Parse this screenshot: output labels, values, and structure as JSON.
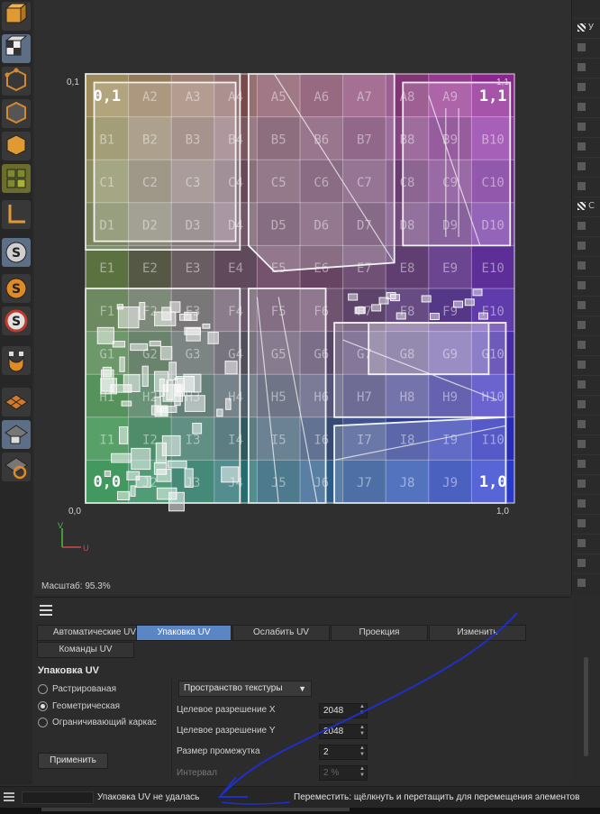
{
  "viewport": {
    "coords": {
      "top_left": "0,1",
      "top_right": "1,1",
      "bottom_left": "0,0",
      "bottom_right": "1,0"
    },
    "axis": {
      "v": "V",
      "u": "U"
    },
    "scale_label": "Масштаб: 95.3%",
    "uv_grid": {
      "rows": [
        "A",
        "B",
        "C",
        "D",
        "E",
        "F",
        "G",
        "H",
        "I",
        "J"
      ],
      "cols": [
        "1",
        "2",
        "3",
        "4",
        "5",
        "6",
        "7",
        "8",
        "9",
        "10"
      ],
      "corner_labels": {
        "top_left": "0,1",
        "top_right": "1,1",
        "bottom_left": "0,0",
        "bottom_right": "1,0"
      }
    }
  },
  "left_toolbar": {
    "icons": [
      "cube-orange-icon",
      "checker-cube-icon",
      "points-mode-icon",
      "edges-mode-icon",
      "polygons-mode-icon",
      "uv-polygons-icon",
      "axis-icon",
      "snap-s-icon",
      "snap-s-orange-icon",
      "snap-s-red-icon",
      "magnet-icon",
      "uv-grid-icon",
      "uv-lock-icon",
      "uv-rotate-icon"
    ]
  },
  "right_panel": {
    "items": [
      "У",
      "",
      "",
      "",
      "",
      "",
      "",
      "",
      "",
      "С",
      "",
      "",
      "",
      "",
      "",
      "",
      "",
      "",
      "",
      "",
      "",
      "",
      "",
      "",
      "",
      "",
      "",
      "",
      ""
    ]
  },
  "tabs": {
    "row1": [
      "Автоматические UV",
      "Упаковка UV",
      "Ослабить UV",
      "Проекция",
      "Изменить"
    ],
    "row2": [
      "Команды UV"
    ],
    "active": "Упаковка UV"
  },
  "packing": {
    "title": "Упаковка UV",
    "methods": [
      "Растрированая",
      "Геометрическая",
      "Ограничивающий каркас"
    ],
    "selected_method": "Геометрическая",
    "texture_space": "Пространство текстуры",
    "props": [
      {
        "label": "Целевое разрешение X",
        "value": "2048"
      },
      {
        "label": "Целевое разрешение Y",
        "value": "2048"
      },
      {
        "label": "Размер промежутка",
        "value": "2"
      },
      {
        "label": "Интервал",
        "value": "2 %"
      }
    ],
    "apply_label": "Применить"
  },
  "status": {
    "message": "Упаковка UV не удалась",
    "hint": "Переместить: щёлкнуть и перетащить для перемещения элементов"
  }
}
